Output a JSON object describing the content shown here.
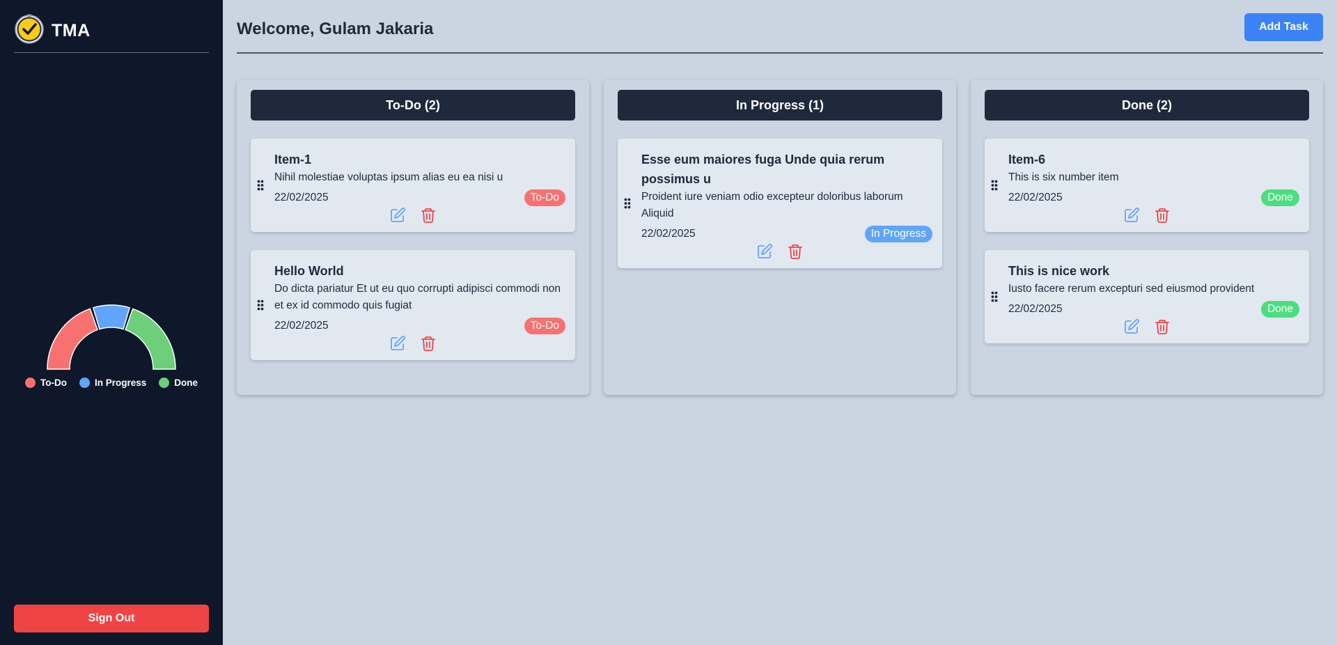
{
  "app": {
    "title": "TMA"
  },
  "header": {
    "welcome": "Welcome, Gulam Jakaria",
    "add_task_label": "Add Task"
  },
  "sidebar": {
    "legend": [
      {
        "label": "To-Do",
        "color": "#f87171"
      },
      {
        "label": "In Progress",
        "color": "#60a5fa"
      },
      {
        "label": "Done",
        "color": "#6ccf7a"
      }
    ],
    "signout_label": "Sign Out"
  },
  "chart_data": {
    "type": "pie",
    "shape": "half-donut",
    "categories": [
      "To-Do",
      "In Progress",
      "Done"
    ],
    "values": [
      2,
      1,
      2
    ],
    "colors": [
      "#f87171",
      "#60a5fa",
      "#6ccf7a"
    ]
  },
  "columns": [
    {
      "header": "To-Do (2)",
      "cards": [
        {
          "title": "Item-1",
          "description": "Nihil molestiae voluptas ipsum alias eu ea nisi u",
          "date": "22/02/2025",
          "status": "To-Do",
          "status_color": "#f87171"
        },
        {
          "title": "Hello World",
          "description": "Do dicta pariatur Et ut eu quo corrupti adipisci commodi non et ex id commodo quis fugiat",
          "date": "22/02/2025",
          "status": "To-Do",
          "status_color": "#f87171"
        }
      ]
    },
    {
      "header": "In Progress (1)",
      "cards": [
        {
          "title": "Esse eum maiores fuga Unde quia rerum possimus u",
          "description": "Proident iure veniam odio excepteur doloribus laborum Aliquid",
          "date": "22/02/2025",
          "status": "In Progress",
          "status_color": "#60a5fa"
        }
      ]
    },
    {
      "header": "Done (2)",
      "cards": [
        {
          "title": "Item-6",
          "description": "This is six number item",
          "date": "22/02/2025",
          "status": "Done",
          "status_color": "#4ade80"
        },
        {
          "title": "This is nice work",
          "description": "Iusto facere rerum excepturi sed eiusmod provident",
          "date": "22/02/2025",
          "status": "Done",
          "status_color": "#4ade80"
        }
      ]
    }
  ],
  "icons": {
    "logo": "clock-check-icon",
    "drag": "drag-handle-icon",
    "edit": "edit-icon",
    "delete": "trash-icon"
  },
  "colors": {
    "sidebar_bg": "#0f172a",
    "page_bg": "#cbd5e1",
    "column_header_bg": "#1e293b",
    "card_bg": "#e2e8f0",
    "accent": "#3b82f6",
    "danger": "#ef4444"
  }
}
